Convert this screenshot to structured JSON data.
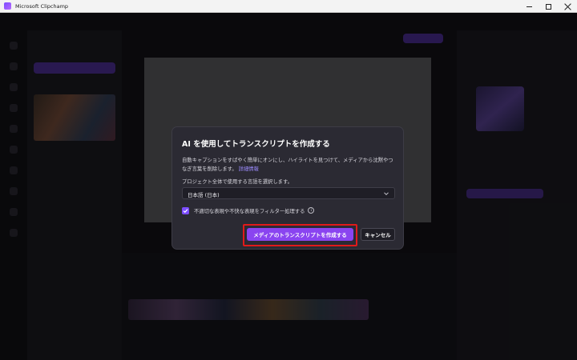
{
  "window": {
    "title": "Microsoft Clipchamp"
  },
  "dialog": {
    "title": "AI を使用してトランスクリプトを作成する",
    "description": "自動キャプションをすばやく簡単にオンにし、ハイライトを見つけて、メディアから沈黙やつなぎ言葉を削除します。",
    "learn_more_link": "詳細情報",
    "language_prompt": "プロジェクト全体で使用する言語を選択します。",
    "language_selected": "日本語 (日本)",
    "filter_checkbox_label": "不適切な表現や不快な表現をフィルター処理する",
    "filter_checked": true,
    "create_button": "メディアのトランスクリプトを作成する",
    "cancel_button": "キャンセル"
  },
  "colors": {
    "accent": "#8a44f0",
    "highlight_outline": "#e01a1a",
    "dialog_bg": "#2b2a33"
  }
}
